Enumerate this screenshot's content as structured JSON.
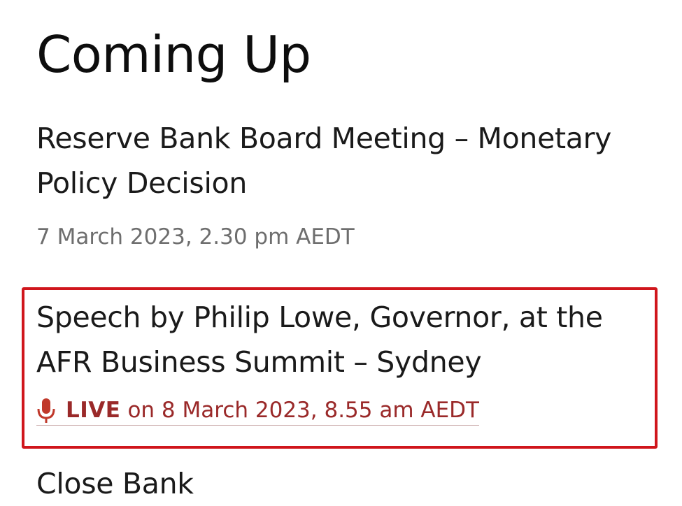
{
  "section": {
    "title": "Coming Up"
  },
  "events": [
    {
      "title": "Reserve Bank Board Meeting – Monetary Policy Decision",
      "date": "7 March 2023, 2.30 pm AEDT"
    },
    {
      "title": "Speech by Philip Lowe, Governor, at the AFR Business Summit – Sydney",
      "live_label": "LIVE",
      "live_text": "on 8 March 2023, 8.55 am AEDT",
      "icon": "microphone-icon",
      "highlighted": true
    },
    {
      "title": "Close Bank"
    }
  ],
  "colors": {
    "highlight_border": "#d0161c",
    "live_text": "#9a2929",
    "date_text": "#6e6e6e"
  }
}
